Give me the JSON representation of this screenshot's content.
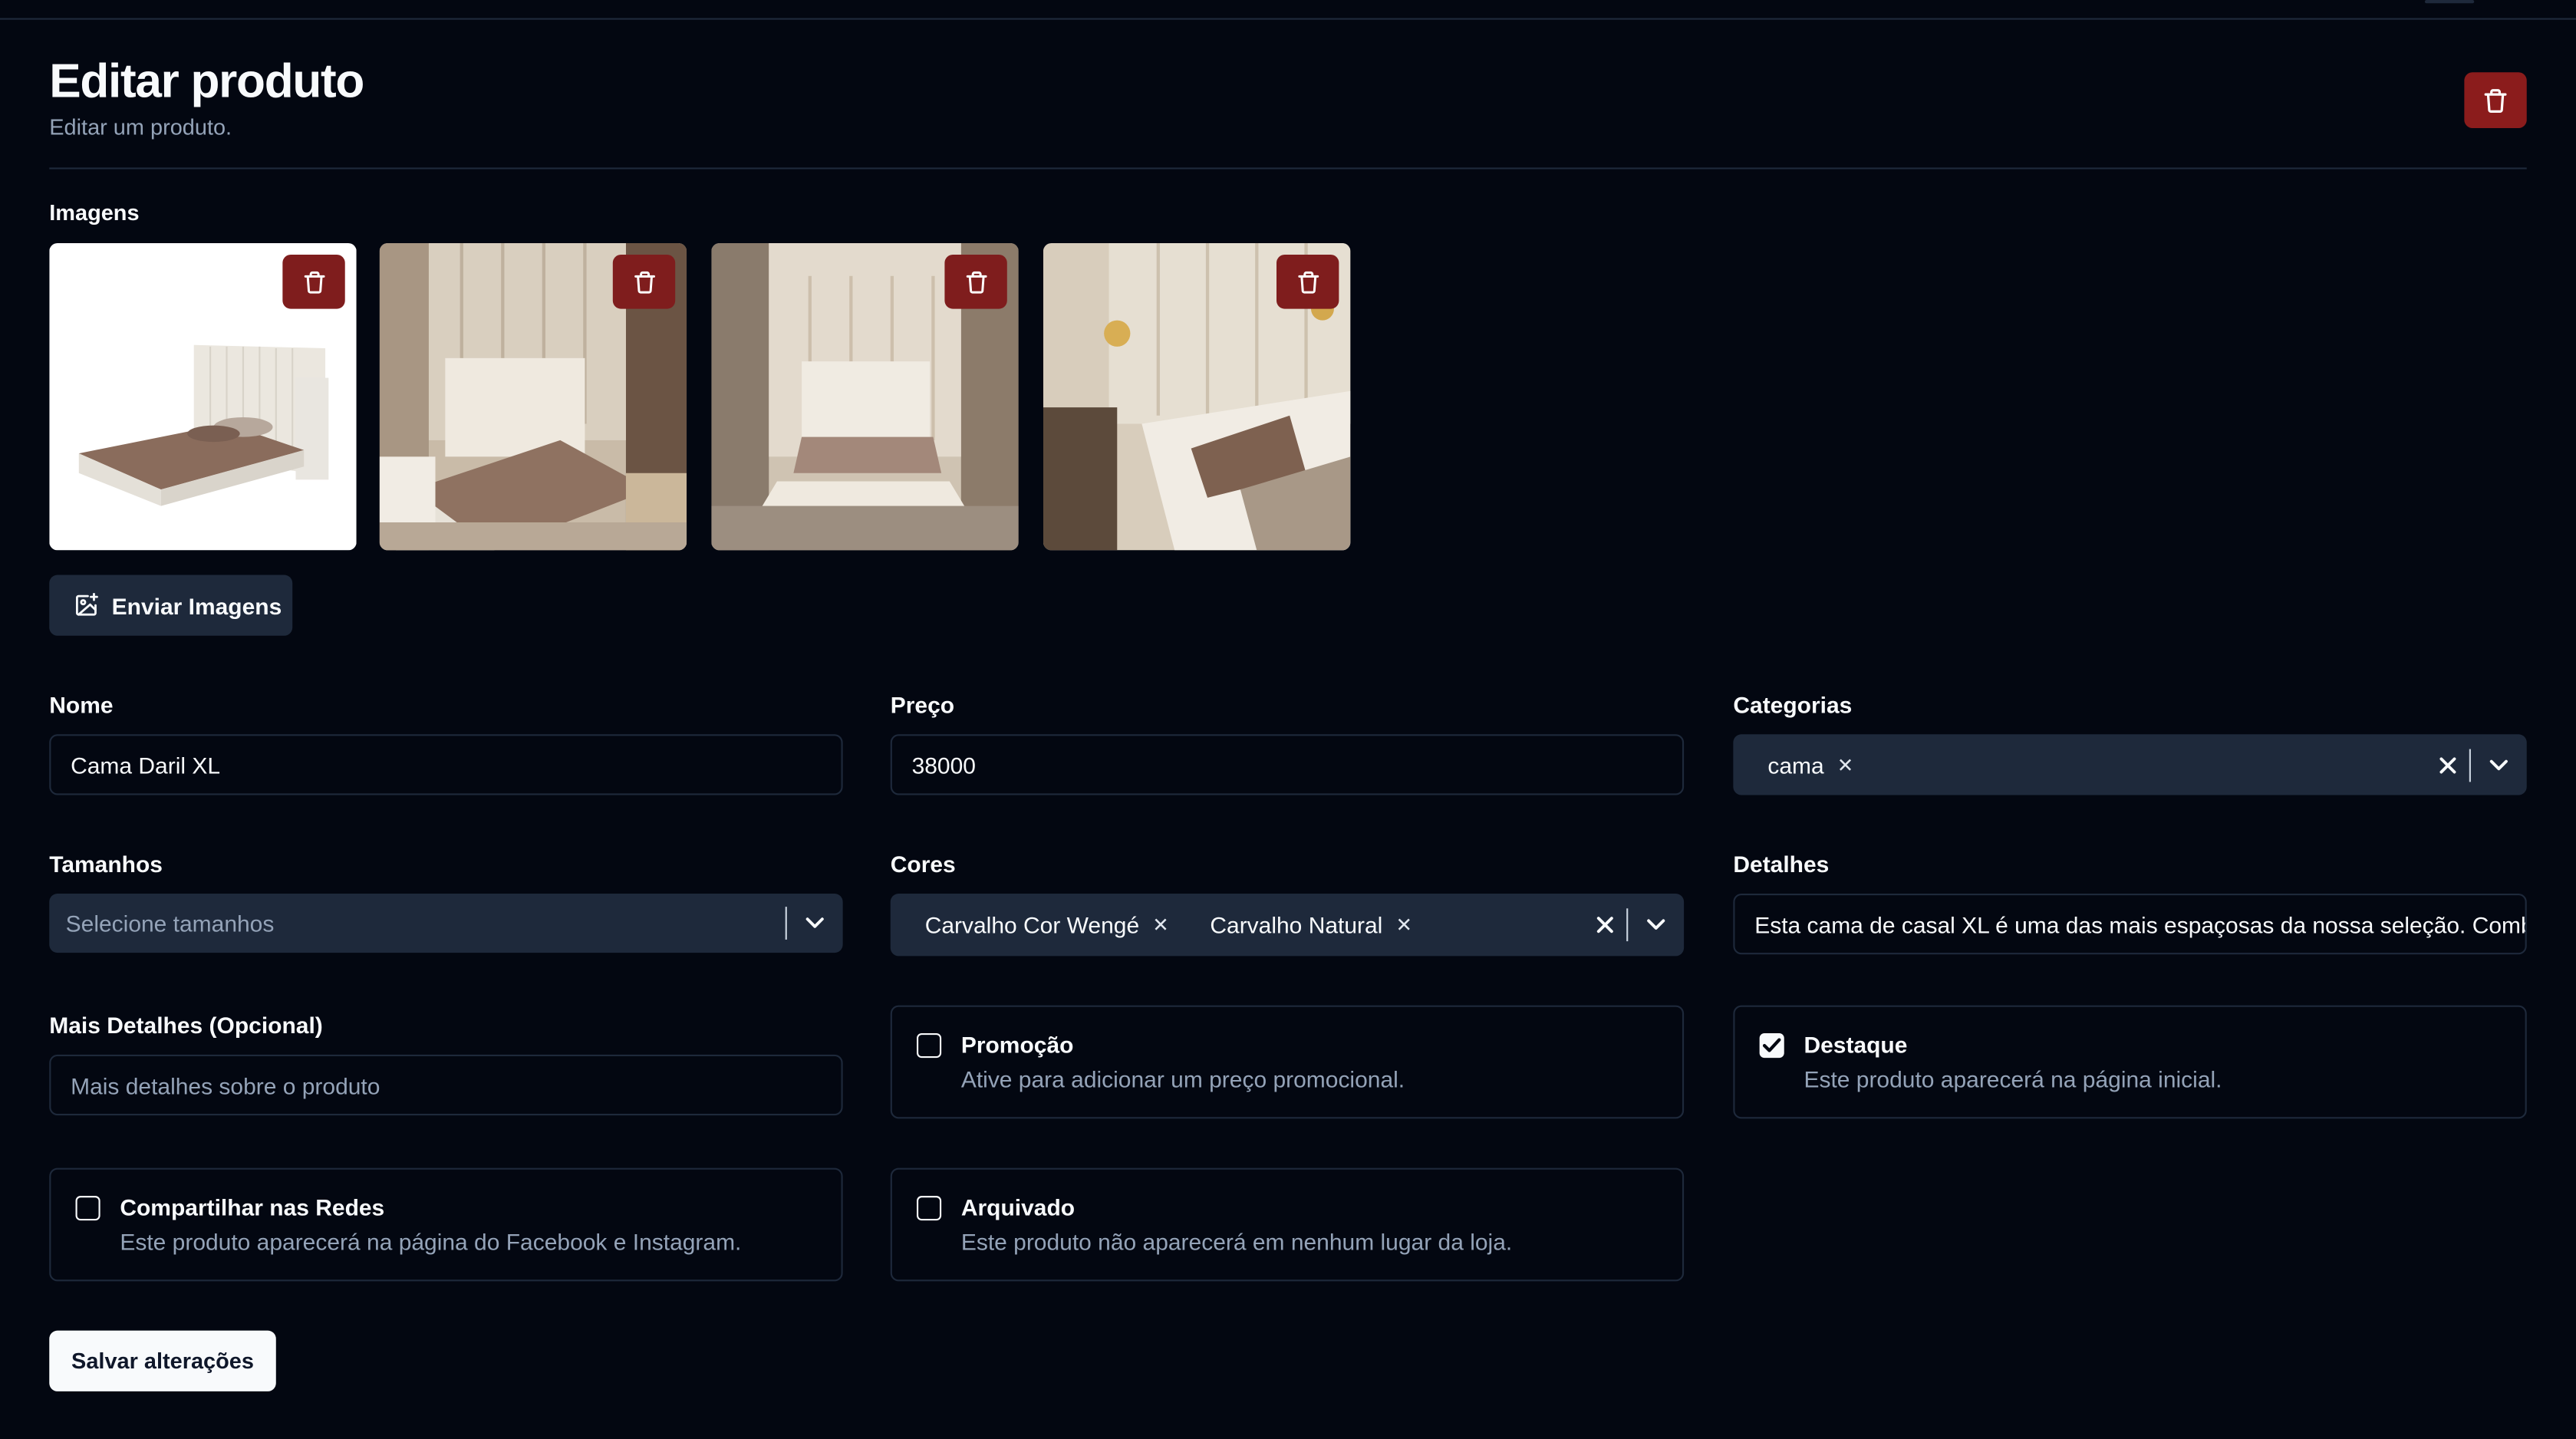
{
  "header": {
    "title": "Editar produto",
    "subtitle": "Editar um produto."
  },
  "images": {
    "label": "Imagens",
    "items": [
      {
        "alt": "cama-1"
      },
      {
        "alt": "cama-2"
      },
      {
        "alt": "cama-3"
      },
      {
        "alt": "cama-4"
      }
    ],
    "upload_label": "Enviar Imagens"
  },
  "form": {
    "nome": {
      "label": "Nome",
      "value": "Cama Daril XL"
    },
    "preco": {
      "label": "Preço",
      "value": "38000"
    },
    "categorias": {
      "label": "Categorias",
      "chips": [
        "cama"
      ]
    },
    "tamanhos": {
      "label": "Tamanhos",
      "placeholder": "Selecione tamanhos"
    },
    "cores": {
      "label": "Cores",
      "chips": [
        "Carvalho Cor Wengé",
        "Carvalho Natural"
      ]
    },
    "detalhes": {
      "label": "Detalhes",
      "value": "Esta cama de casal XL é uma das mais espaçosas da nossa seleção. Combina"
    },
    "mais_detalhes": {
      "label": "Mais Detalhes (Opcional)",
      "placeholder": "Mais detalhes sobre o produto"
    }
  },
  "checks": {
    "promocao": {
      "title": "Promoção",
      "desc": "Ative para adicionar um preço promocional.",
      "checked": false
    },
    "destaque": {
      "title": "Destaque",
      "desc": "Este produto aparecerá na página inicial.",
      "checked": true
    },
    "compartilhar": {
      "title": "Compartilhar nas Redes",
      "desc": "Este produto aparecerá na página do Facebook e Instagram.",
      "checked": false
    },
    "arquivado": {
      "title": "Arquivado",
      "desc": "Este produto não aparecerá em nenhum lugar da loja.",
      "checked": false
    }
  },
  "save_label": "Salvar alterações",
  "colors": {
    "background": "#030711",
    "danger": "#7f1d1d",
    "muted": "#94a3b8",
    "surface": "#1e293b"
  }
}
